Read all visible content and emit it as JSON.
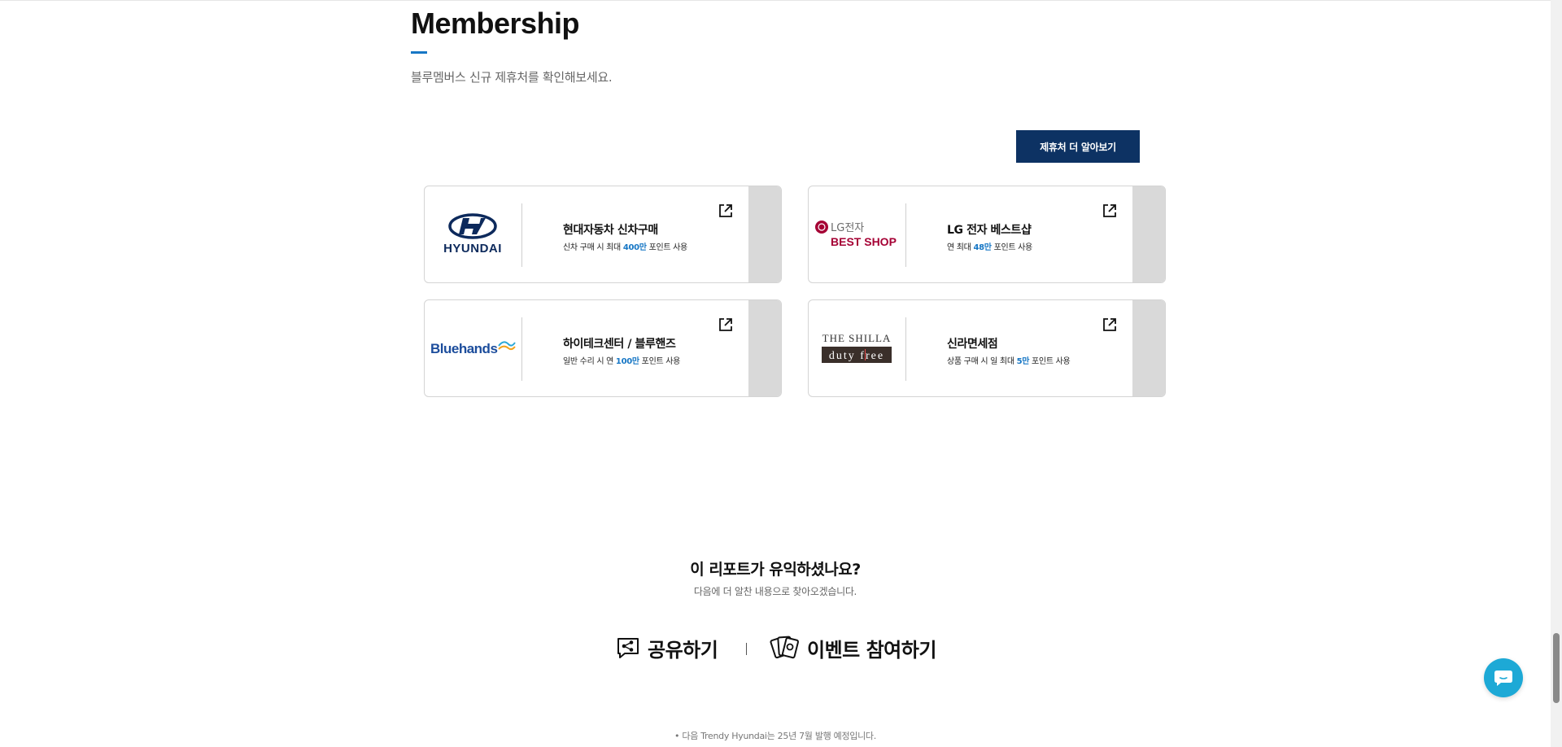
{
  "header": {
    "title": "Membership",
    "subtitle": "블루멤버스 신규 제휴처를 확인해보세요."
  },
  "more_button": "제휴처 더 알아보기",
  "partners": [
    {
      "title": "현대자동차 신차구매",
      "desc_pre": "신차 구매 시 최대 ",
      "desc_hl": "400만",
      "desc_post": " 포인트 사용",
      "logo_text": "HYUNDAI",
      "logo_icon": "hyundai-logo"
    },
    {
      "title": "LG 전자 베스트샵",
      "desc_pre": "연 최대 ",
      "desc_hl": "48만",
      "desc_post": " 포인트 사용",
      "logo_text": "LG전자",
      "logo_text2": "BEST SHOP",
      "logo_icon": "lg-bestshop-logo"
    },
    {
      "title": "하이테크센터 / 블루핸즈",
      "desc_pre": "일반 수리 시 연 ",
      "desc_hl": "100만",
      "desc_post": " 포인트 사용",
      "logo_text": "Bluehands",
      "logo_icon": "bluehands-logo"
    },
    {
      "title": "신라면세점",
      "desc_pre": "상품 구매 시 일 최대 ",
      "desc_hl": "5만",
      "desc_post": " 포인트 사용",
      "logo_text": "THE SHILLA",
      "logo_text2": "duty free",
      "logo_icon": "shilla-logo"
    }
  ],
  "feedback": {
    "title": "이 리포트가 유익하셨나요?",
    "subtitle": "다음에 더 알찬 내용으로 찾아오겠습니다.",
    "share_label": "공유하기",
    "event_label": "이벤트 참여하기",
    "separator": "|"
  },
  "footnote": "• 다음 Trendy Hyundai는 25년 7월 발행 예정입니다.",
  "colors": {
    "accent": "#1777c5",
    "button_bg": "#0d3263",
    "chat_button": "#1da9d6",
    "lg_red": "#a50034",
    "bluehands_blue": "#1c4d9c"
  }
}
